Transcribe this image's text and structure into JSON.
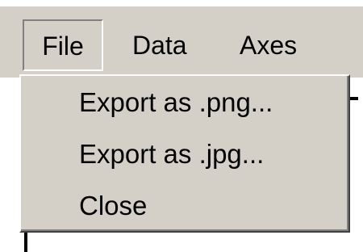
{
  "menubar": {
    "file_label": "File",
    "data_label": "Data",
    "axes_label": "Axes"
  },
  "file_menu": {
    "items": [
      {
        "label": "Export as .png..."
      },
      {
        "label": "Export as .jpg..."
      },
      {
        "label": "Close"
      }
    ]
  },
  "colors": {
    "menu_background": "#d4d0c8",
    "text": "#000000",
    "highlight": "#ffffff",
    "shadow": "#808080"
  }
}
